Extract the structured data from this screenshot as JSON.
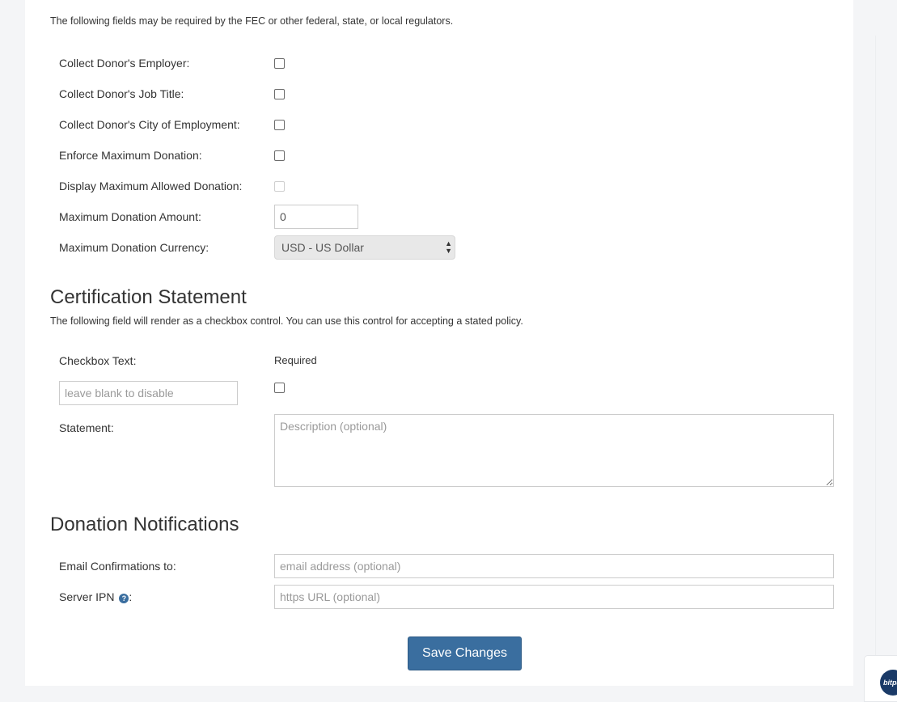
{
  "compliance": {
    "intro": "The following fields may be required by the FEC or other federal, state, or local regulators.",
    "fields": {
      "employer": {
        "label": "Collect Donor's Employer:",
        "checked": false
      },
      "job_title": {
        "label": "Collect Donor's Job Title:",
        "checked": false
      },
      "city": {
        "label": "Collect Donor's City of Employment:",
        "checked": false
      },
      "enforce_max": {
        "label": "Enforce Maximum Donation:",
        "checked": false
      },
      "display_max": {
        "label": "Display Maximum Allowed Donation:",
        "checked": false,
        "disabled": true
      },
      "max_amount": {
        "label": "Maximum Donation Amount:",
        "value": "0"
      },
      "max_currency": {
        "label": "Maximum Donation Currency:",
        "selected": "USD - US Dollar"
      }
    }
  },
  "certification": {
    "title": "Certification Statement",
    "description": "The following field will render as a checkbox control. You can use this control for accepting a stated policy.",
    "checkbox_text_label": "Checkbox Text:",
    "required_label": "Required",
    "checkbox_text_placeholder": "leave blank to disable",
    "required_checked": false,
    "statement_label": "Statement:",
    "statement_placeholder": "Description (optional)"
  },
  "notifications": {
    "title": "Donation Notifications",
    "email_label": "Email Confirmations to:",
    "email_placeholder": "email address (optional)",
    "ipn_label": "Server IPN",
    "ipn_suffix": ":",
    "ipn_help_icon": "question-circle-icon",
    "ipn_placeholder": "https URL (optional)"
  },
  "actions": {
    "save_label": "Save Changes"
  },
  "chat_widget": {
    "icon": "bitpay-chat-icon",
    "logo_text": "bitpay"
  },
  "colors": {
    "primary_button": "#3a6e9f",
    "page_background": "#f4f5f7",
    "panel_background": "#ffffff",
    "select_background": "#e8e8e8"
  }
}
